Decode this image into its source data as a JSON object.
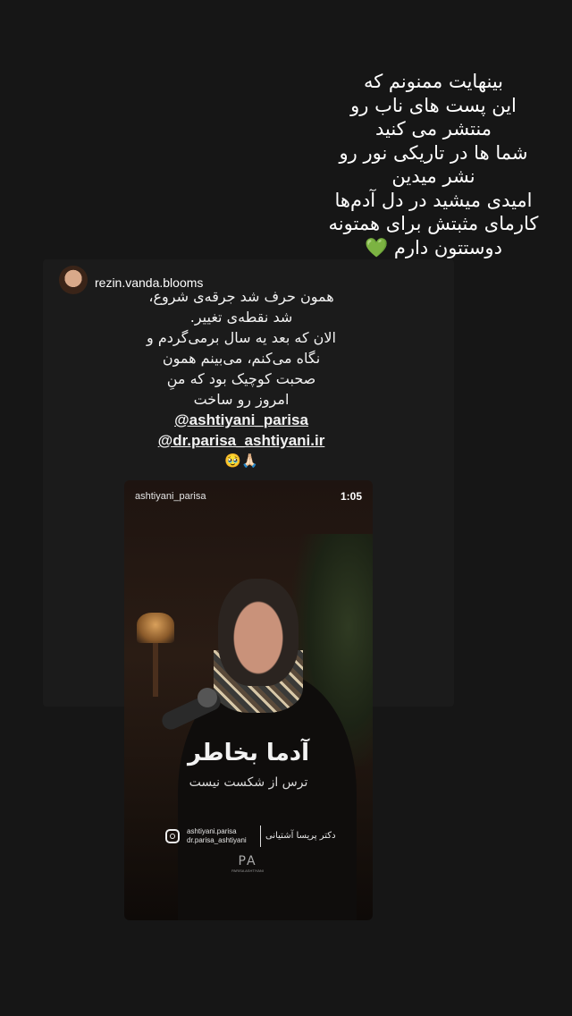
{
  "story_text": [
    "بینهایت ممنونم که",
    "این پست های ناب رو",
    "منتشر می کنید",
    "شما ها در تاریکی نور رو",
    "نشر میدین",
    "امیدی میشید در دل آدم‌ها",
    "کارمای مثبتش برای همتونه",
    "دوستتون دارم 💚"
  ],
  "post": {
    "username": "rezin.vanda.blooms",
    "caption_lines": [
      "همون حرف شد جرقه‌ی شروع،",
      "شد نقطه‌ی تغییر.",
      "الان که بعد یه سال برمی‌گردم و",
      "نگاه می‌کنم، می‌بینم همون",
      "صحبت کوچیک بود که منِ",
      "امروز رو ساخت"
    ],
    "mentions": [
      "@ashtiyani_parisa",
      "@dr.parisa_ashtiyani.ir"
    ],
    "emojis": "🙏🏻🥹"
  },
  "video": {
    "owner": "ashtiyani_parisa",
    "duration": "1:05",
    "overlay_title": "آدما بخاطر",
    "overlay_subtitle": "ترس از شکست نیست",
    "credit_handle_1": "ashtiyani.parisa",
    "credit_handle_2": "dr.parisa_ashtiyani",
    "credit_name": "دکتر پریسا آشتیانی",
    "brand_glyph": "PA",
    "brand_text": "PARISA ASHTIYANI"
  },
  "colors": {
    "background": "#161616",
    "heart": "#2ecc40"
  }
}
